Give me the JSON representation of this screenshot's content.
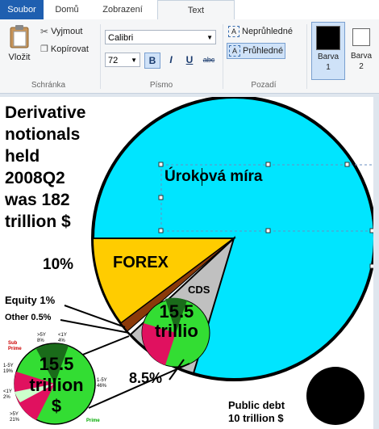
{
  "tabs": {
    "file": "Soubor",
    "home": "Domů",
    "view": "Zobrazení",
    "text": "Text"
  },
  "clipboard": {
    "paste": "Vložit",
    "cut": "Vyjmout",
    "copy": "Kopírovat",
    "group": "Schránka"
  },
  "font": {
    "family": "Calibri",
    "size": "72",
    "bold": "B",
    "italic": "I",
    "underline": "U",
    "strike": "abc",
    "group": "Písmo"
  },
  "background": {
    "opaque": "Neprůhledné",
    "transparent": "Průhledné",
    "group": "Pozadí"
  },
  "colors": {
    "color1": "Barva 1",
    "color2": "Barva 2",
    "color1_value": "#000000",
    "color2_value": "#ffffff"
  },
  "canvas": {
    "title_lines": [
      "Derivative",
      "notionals",
      "held",
      "2008Q2",
      "was 182",
      "trillion $"
    ],
    "interest_label": "Úroková míra",
    "forex_label": "FOREX",
    "forex_pct": "10%",
    "cds_label": "CDS",
    "cds_value_lines": [
      "15.5",
      "trillio"
    ],
    "equity_label": "Equity 1%",
    "other_label": "Other 0.5%",
    "cds_pct": "8.5%",
    "small_labels": [
      ">5Y 8%",
      "<1Y 4%",
      "Sub Prime",
      "1-5Y 19%",
      "<1Y 2%",
      ">5Y 21%",
      "1-5Y 46%",
      "Prime"
    ],
    "small_value_lines": [
      "15.5",
      "trillion",
      "$"
    ],
    "public_debt_lines": [
      "Public debt",
      "10 trillion $"
    ]
  },
  "accent": {
    "file_tab": "#1f5fb0",
    "cyan": "#00e5ff",
    "forex": "#ffcc00",
    "cds": "#c0c0c0",
    "prime": "#33dd33",
    "subprime": "#e0115f"
  }
}
